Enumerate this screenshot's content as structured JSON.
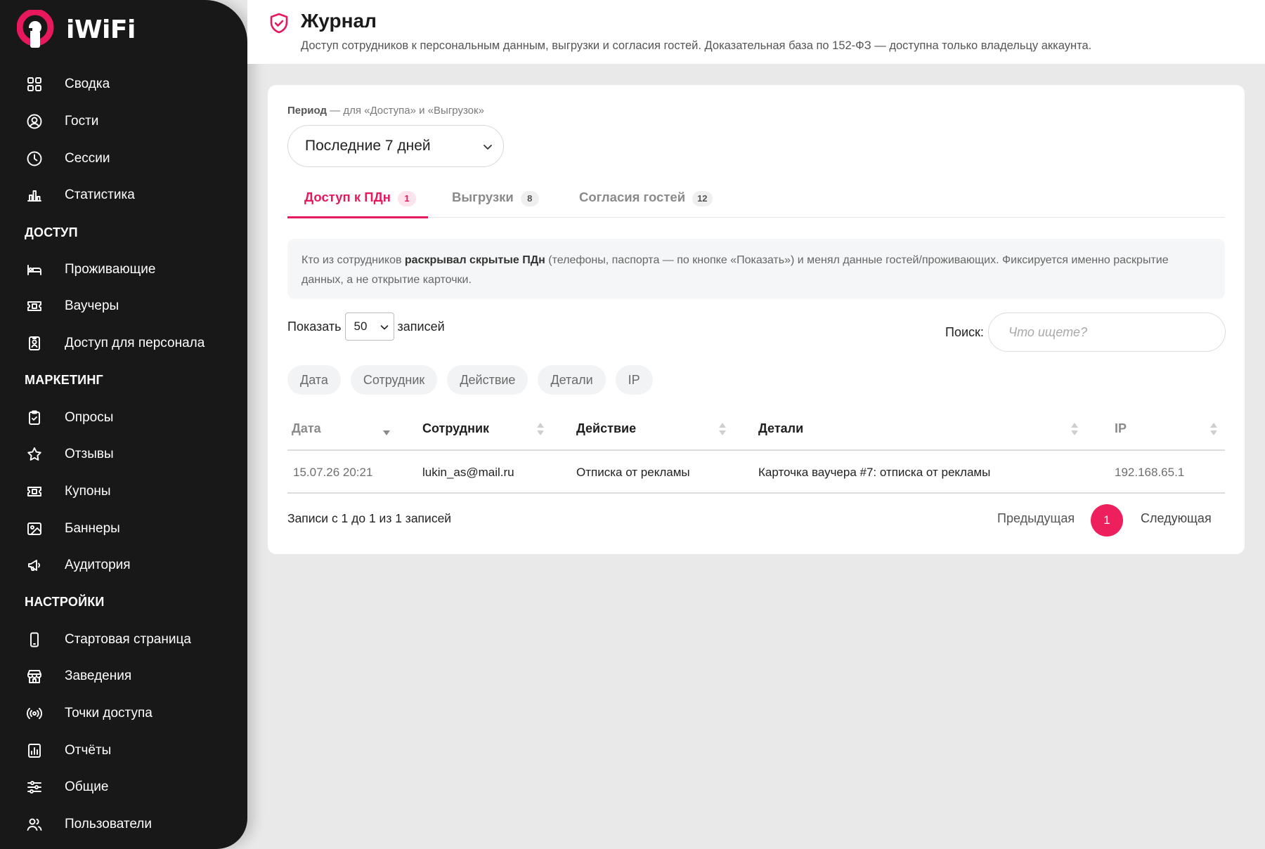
{
  "app": {
    "logo_text": "iWiFi",
    "accent": "#e8185c"
  },
  "sidebar": {
    "groups": [
      {
        "section": "",
        "items": [
          {
            "label": "Сводка",
            "icon": "dashboard-icon"
          },
          {
            "label": "Гости",
            "icon": "user-circle-icon"
          },
          {
            "label": "Сессии",
            "icon": "clock-icon"
          },
          {
            "label": "Статистика",
            "icon": "bar-chart-icon"
          }
        ]
      },
      {
        "section": "ДОСТУП",
        "items": [
          {
            "label": "Проживающие",
            "icon": "bed-icon"
          },
          {
            "label": "Ваучеры",
            "icon": "ticket-icon"
          },
          {
            "label": "Доступ для персонала",
            "icon": "badge-icon"
          }
        ]
      },
      {
        "section": "МАРКЕТИНГ",
        "items": [
          {
            "label": "Опросы",
            "icon": "clipboard-icon"
          },
          {
            "label": "Отзывы",
            "icon": "star-icon"
          },
          {
            "label": "Купоны",
            "icon": "coupon-icon"
          },
          {
            "label": "Баннеры",
            "icon": "image-icon"
          },
          {
            "label": "Аудитория",
            "icon": "megaphone-icon"
          }
        ]
      },
      {
        "section": "НАСТРОЙКИ",
        "items": [
          {
            "label": "Стартовая страница",
            "icon": "phone-icon"
          },
          {
            "label": "Заведения",
            "icon": "store-icon"
          },
          {
            "label": "Точки доступа",
            "icon": "broadcast-icon"
          },
          {
            "label": "Отчёты",
            "icon": "report-icon"
          },
          {
            "label": "Общие",
            "icon": "sliders-icon"
          },
          {
            "label": "Пользователи",
            "icon": "users-icon"
          }
        ]
      }
    ]
  },
  "header": {
    "title": "Журнал",
    "subtitle": "Доступ сотрудников к персональным данным, выгрузки и согласия гостей. Доказательная база по 152-ФЗ — доступна только владельцу аккаунта.",
    "icon": "shield-check-icon"
  },
  "period": {
    "label_bold": "Период",
    "label_rest": " — для «Доступа» и «Выгрузок»",
    "value": "Последние 7 дней"
  },
  "tabs": [
    {
      "label": "Доступ к ПДн",
      "count": "1",
      "active": true
    },
    {
      "label": "Выгрузки",
      "count": "8",
      "active": false
    },
    {
      "label": "Согласия гостей",
      "count": "12",
      "active": false
    }
  ],
  "info": {
    "part1": "Кто из сотрудников ",
    "bold": "раскрывал скрытые ПДн",
    "part2": " (телефоны, паспорта — по кнопке «Показать») и менял данные гостей/проживающих. Фиксируется именно раскрытие данных, а не открытие карточки."
  },
  "length": {
    "prefix": "Показать",
    "value": "50",
    "suffix": "записей"
  },
  "search": {
    "label": "Поиск:",
    "placeholder": "Что ищете?",
    "value": ""
  },
  "column_chips": [
    "Дата",
    "Сотрудник",
    "Действие",
    "Детали",
    "IP"
  ],
  "table": {
    "columns": [
      "Дата",
      "Сотрудник",
      "Действие",
      "Детали",
      "IP"
    ],
    "rows": [
      [
        "15.07.26 20:21",
        "lukin_as@mail.ru",
        "Отписка от рекламы",
        "Карточка ваучера #7: отписка от рекламы",
        "192.168.65.1"
      ]
    ]
  },
  "pagination": {
    "info": "Записи с 1 до 1 из 1 записей",
    "prev": "Предыдущая",
    "current": "1",
    "next": "Следующая"
  }
}
